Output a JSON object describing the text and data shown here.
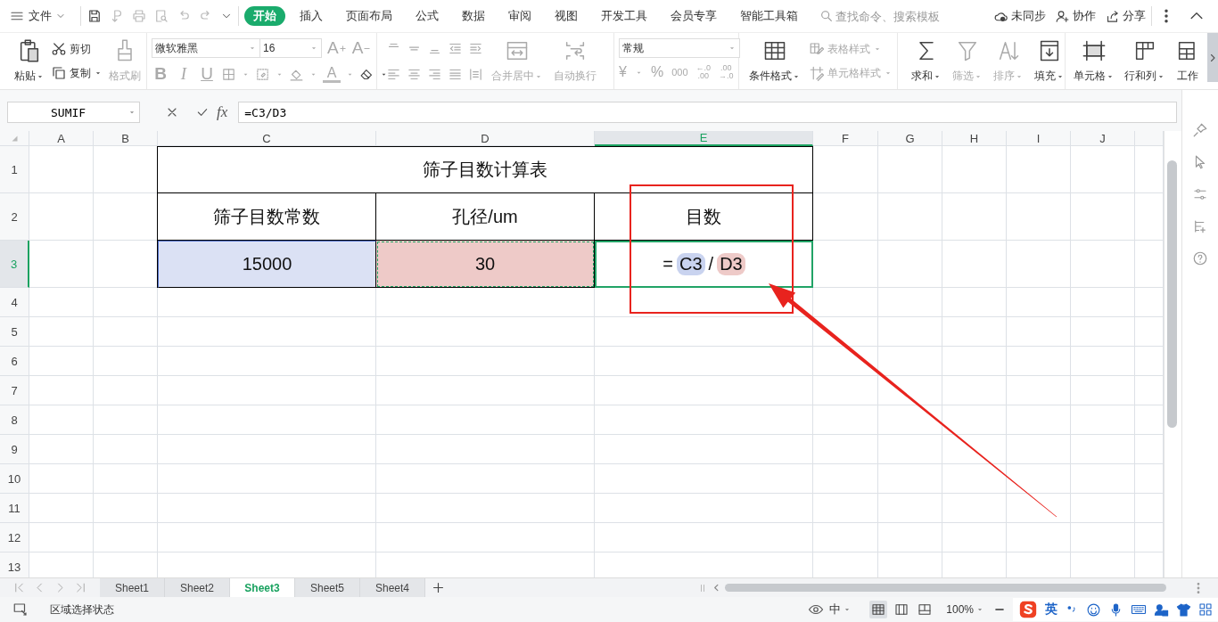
{
  "menu_bar": {
    "file": "文件",
    "tabs": [
      {
        "label": "开始",
        "selected": true
      },
      {
        "label": "插入",
        "selected": false
      },
      {
        "label": "页面布局",
        "selected": false
      },
      {
        "label": "公式",
        "selected": false
      },
      {
        "label": "数据",
        "selected": false
      },
      {
        "label": "审阅",
        "selected": false
      },
      {
        "label": "视图",
        "selected": false
      },
      {
        "label": "开发工具",
        "selected": false
      },
      {
        "label": "会员专享",
        "selected": false
      },
      {
        "label": "智能工具箱",
        "selected": false
      }
    ],
    "search": {
      "placeholder": "查找命令、搜索模板"
    },
    "actions": [
      {
        "label": "未同步"
      },
      {
        "label": "协作"
      },
      {
        "label": "分享"
      }
    ]
  },
  "ribbon": {
    "clipboard": [
      {
        "label": "粘贴",
        "dropdown": true,
        "disabled": false
      },
      {
        "label": "剪切",
        "dropdown": false,
        "disabled": false
      },
      {
        "label": "复制",
        "dropdown": true,
        "disabled": false
      },
      {
        "label": "格式刷",
        "dropdown": false,
        "disabled": true
      }
    ],
    "font": {
      "name": "微软雅黑",
      "size": "16",
      "grow": "A",
      "shrink": "A",
      "styles": [
        "B",
        "I",
        "U"
      ],
      "color_label": "A"
    },
    "alignment": [
      {
        "label": "合并居中",
        "dropdown": true,
        "disabled": true
      },
      {
        "label": "自动换行",
        "dropdown": false,
        "disabled": true
      }
    ],
    "number": {
      "format": "常规",
      "currency": "¥",
      "percent": "%",
      "thousands": "000",
      "decimals": [
        {
          "top": "←.0",
          "bottom": ".00"
        },
        {
          "top": ".00",
          "bottom": "→.0"
        }
      ]
    },
    "styles": [
      {
        "label": "条件格式",
        "dropdown": true,
        "disabled": false
      },
      {
        "label": "表格样式",
        "dropdown": true,
        "disabled": true
      },
      {
        "label": "单元格样式",
        "dropdown": true,
        "disabled": true
      }
    ],
    "editing": [
      {
        "label": "求和",
        "dropdown": true,
        "disabled": false
      },
      {
        "label": "筛选",
        "dropdown": true,
        "disabled": true
      },
      {
        "label": "排序",
        "dropdown": true,
        "disabled": true
      },
      {
        "label": "填充",
        "dropdown": true,
        "disabled": false
      },
      {
        "label": "单元格",
        "dropdown": true,
        "disabled": false
      },
      {
        "label": "行和列",
        "dropdown": true,
        "disabled": false
      },
      {
        "label": "工作",
        "dropdown": false,
        "disabled": false
      }
    ]
  },
  "formula_bar": {
    "name_box": "SUMIF",
    "function_label": "fx",
    "formula": "=C3/D3"
  },
  "sheet": {
    "columns": [
      {
        "label": "A",
        "selected": false
      },
      {
        "label": "B",
        "selected": false
      },
      {
        "label": "C",
        "selected": false
      },
      {
        "label": "D",
        "selected": false
      },
      {
        "label": "E",
        "selected": true
      },
      {
        "label": "F",
        "selected": false
      },
      {
        "label": "G",
        "selected": false
      },
      {
        "label": "H",
        "selected": false
      },
      {
        "label": "I",
        "selected": false
      },
      {
        "label": "J",
        "selected": false
      }
    ],
    "rows": [
      {
        "label": "1",
        "selected": false
      },
      {
        "label": "2",
        "selected": false
      },
      {
        "label": "3",
        "selected": true
      },
      {
        "label": "4",
        "selected": false
      },
      {
        "label": "5",
        "selected": false
      },
      {
        "label": "6",
        "selected": false
      },
      {
        "label": "7",
        "selected": false
      },
      {
        "label": "8",
        "selected": false
      },
      {
        "label": "9",
        "selected": false
      },
      {
        "label": "10",
        "selected": false
      },
      {
        "label": "11",
        "selected": false
      },
      {
        "label": "12",
        "selected": false
      },
      {
        "label": "13",
        "selected": false
      }
    ],
    "title": "筛子目数计算表",
    "headers": [
      "筛子目数常数",
      "孔径/um",
      "目数"
    ],
    "values": [
      {
        "text": "15000",
        "color": "#dbe1f4"
      },
      {
        "text": "30",
        "color": "#eecac8"
      }
    ],
    "formula_parts": [
      {
        "text": "=",
        "kind": "plain"
      },
      {
        "text": "C3",
        "kind": "ref",
        "color": "#c9d3ef"
      },
      {
        "text": "/",
        "kind": "plain"
      },
      {
        "text": "D3",
        "kind": "ref",
        "color": "#eecac8"
      }
    ],
    "annotation": {
      "highlight_box": true,
      "arrow": true
    }
  },
  "sheet_tabs": [
    {
      "label": "Sheet1",
      "selected": false
    },
    {
      "label": "Sheet2",
      "selected": false
    },
    {
      "label": "Sheet3",
      "selected": true
    },
    {
      "label": "Sheet5",
      "selected": false
    },
    {
      "label": "Sheet4",
      "selected": false
    }
  ],
  "status_bar": {
    "mode": "区域选择状态",
    "input_mode": "中",
    "views": [
      {
        "selected": true
      },
      {
        "selected": false
      },
      {
        "selected": false
      }
    ],
    "zoom": "100%",
    "ime_language": "英"
  }
}
